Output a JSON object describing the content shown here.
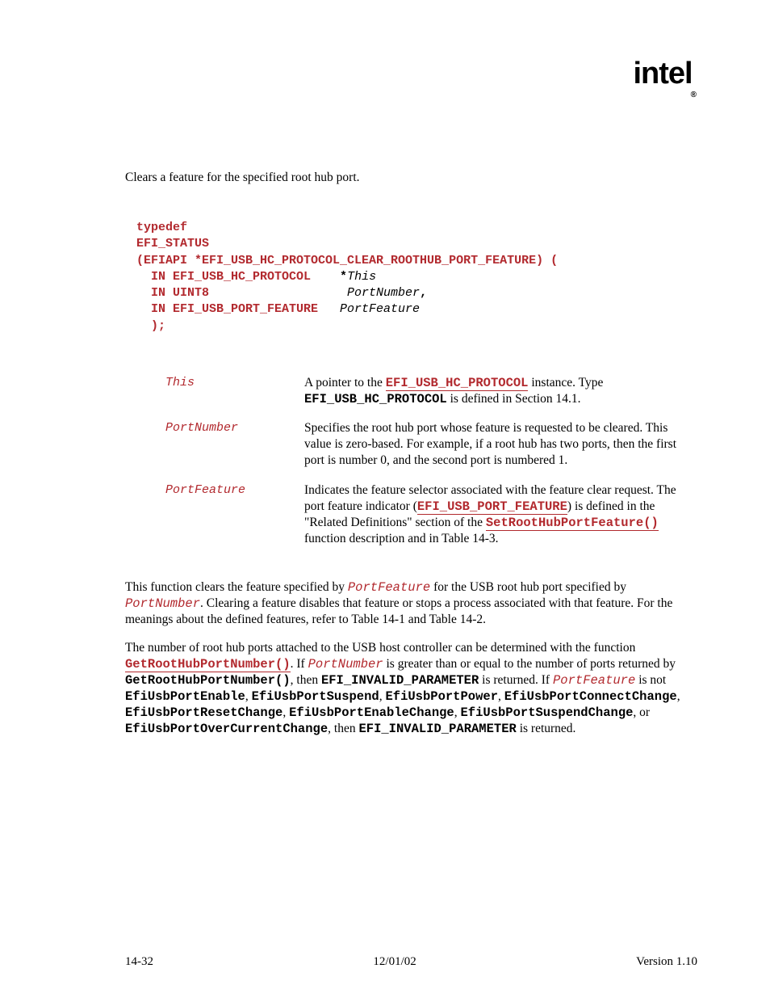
{
  "brand": "intel",
  "brand_sub": "®",
  "summary": "Clears a feature for the specified root hub port.",
  "prototype": {
    "l1": "typedef",
    "l2": "EFI_STATUS",
    "l3a": "(EFIAPI *EFI_USB_HC_PROTOCOL_CLEAR_ROOTHUB_PORT_FEATURE) (",
    "l4type": "  IN EFI_USB_HC_PROTOCOL    ",
    "l4star": "*",
    "l4param": "This",
    "l5type": "  IN UINT8                   ",
    "l5param": "PortNumber",
    "l5comma": ",",
    "l6type": "  IN EFI_USB_PORT_FEATURE   ",
    "l6param": "PortFeature",
    "l7": "  );"
  },
  "params": {
    "this": {
      "name": "This",
      "d1": "A pointer to the ",
      "d2": "EFI_USB_HC_PROTOCOL",
      "d3": " instance.  Type ",
      "d4": "EFI_USB_HC_PROTOCOL",
      "d5": " is defined in Section 14.1."
    },
    "portNumber": {
      "name": "PortNumber",
      "d1": "Specifies the root hub port whose feature is requested to be cleared.  This value is zero-based. For example, if a root hub has two ports, then the first port is number 0, and the second port is numbered 1."
    },
    "portFeature": {
      "name": "PortFeature",
      "d1": "Indicates the feature selector associated with the feature clear request.  The port feature indicator (",
      "d2": "EFI_USB_PORT_FEATURE",
      "d3": ") is defined in the \"Related Definitions\" section of the ",
      "d4": "SetRootHubPortFeature()",
      "d5": " function description and in Table 14-3."
    }
  },
  "desc": {
    "p1a": "This function clears the feature specified by ",
    "p1b": "PortFeature",
    "p1c": " for the USB root hub port specified by ",
    "p1d": "PortNumber",
    "p1e": ".  Clearing a feature disables that feature or stops a process associated with that feature.  For the meanings about the defined features, refer to Table 14-1 and Table 14-2.",
    "p2a": "The number of root hub ports attached to the USB host controller can be determined with the function ",
    "p2b": "GetRootHubPortNumber()",
    "p2c": ".  If ",
    "p2d": "PortNumber",
    "p2e": " is greater than or equal to the number of ports returned by ",
    "p2f": "GetRootHubPortNumber()",
    "p2g": ", then ",
    "p2h": "EFI_INVALID_PARAMETER",
    "p2i": " is returned.  If ",
    "p2j": "PortFeature",
    "p2k": " is not ",
    "p2l": "EfiUsbPortEnable",
    "p2m": ", ",
    "p2n": "EfiUsbPortSuspend",
    "p2o": ", ",
    "p2p": "EfiUsbPortPower",
    "p2q": ", ",
    "p2r": "EfiUsbPortConnectChange",
    "p2s": ", ",
    "p2t": "EfiUsbPortResetChange",
    "p2u": ", ",
    "p2v": "EfiUsbPortEnableChange",
    "p2w": ", ",
    "p2x": "EfiUsbPortSuspendChange",
    "p2y": ", or ",
    "p2z": "EfiUsbPortOverCurrentChange",
    "p2aa": ", then ",
    "p2ab": "EFI_INVALID_PARAMETER",
    "p2ac": " is returned."
  },
  "footer": {
    "left": "14-32",
    "center": "12/01/02",
    "right": "Version 1.10"
  }
}
